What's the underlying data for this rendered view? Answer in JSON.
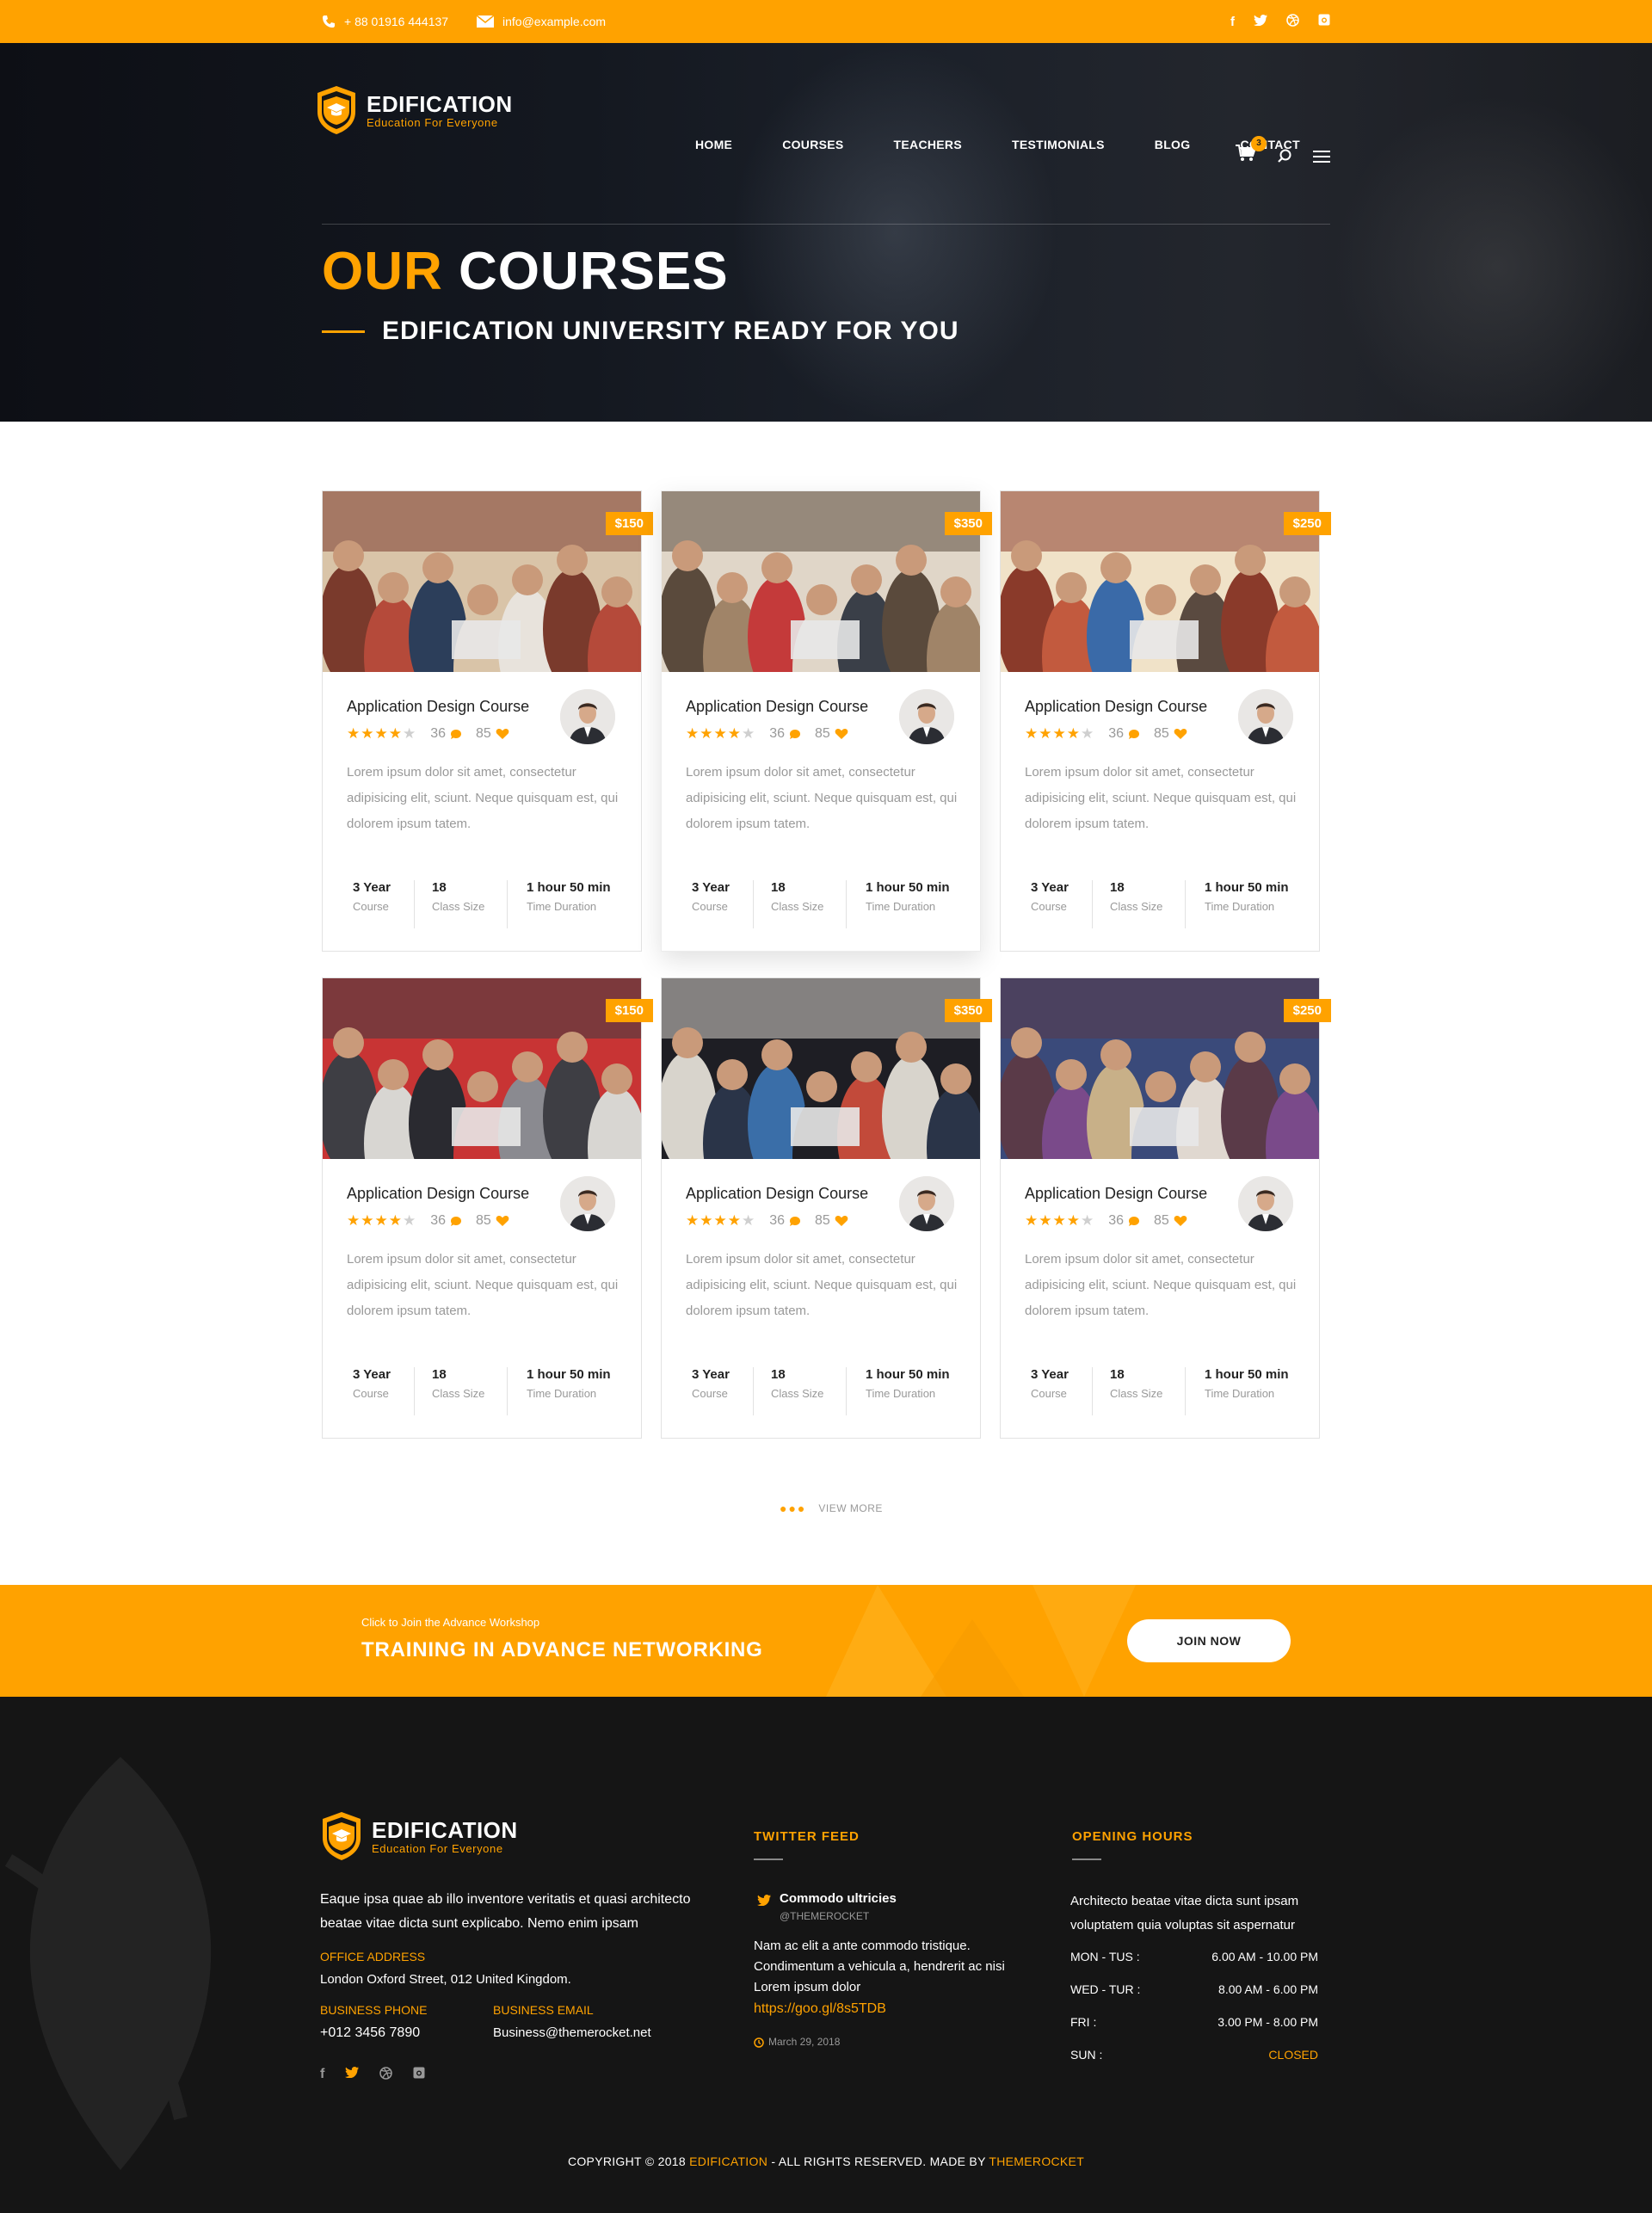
{
  "topbar": {
    "phone": "+ 88 01916 444137",
    "email": "info@example.com",
    "social": [
      "f",
      "t",
      "d",
      "i"
    ]
  },
  "brand": {
    "name": "EDIFICATION",
    "tagline": "Education For Everyone"
  },
  "nav": {
    "items": [
      "HOME",
      "COURSES",
      "TEACHERS",
      "TESTIMONIALS",
      "BLOG",
      "CONTACT"
    ],
    "cart_count": "3"
  },
  "hero": {
    "title_highlight": "OUR",
    "title_rest": "COURSES",
    "subtitle": "EDIFICATION UNIVERSITY READY FOR YOU"
  },
  "courses": [
    {
      "price": "$150",
      "title": "Application Design Course",
      "rating": 4,
      "comments": "36",
      "likes": "85",
      "description": "Lorem ipsum dolor sit amet, consectetur adipisicing elit, sciunt. Neque quisquam est, qui dolorem ipsum tatem.",
      "stats": [
        {
          "value": "3 Year",
          "label": "Course"
        },
        {
          "value": "18",
          "label": "Class Size"
        },
        {
          "value": "1 hour 50 min",
          "label": "Time Duration"
        }
      ]
    },
    {
      "price": "$350",
      "title": "Application Design Course",
      "rating": 4,
      "comments": "36",
      "likes": "85",
      "description": "Lorem ipsum dolor sit amet, consectetur adipisicing elit, sciunt. Neque quisquam est, qui dolorem ipsum tatem.",
      "stats": [
        {
          "value": "3 Year",
          "label": "Course"
        },
        {
          "value": "18",
          "label": "Class Size"
        },
        {
          "value": "1 hour 50 min",
          "label": "Time Duration"
        }
      ]
    },
    {
      "price": "$250",
      "title": "Application Design Course",
      "rating": 4,
      "comments": "36",
      "likes": "85",
      "description": "Lorem ipsum dolor sit amet, consectetur adipisicing elit, sciunt. Neque quisquam est, qui dolorem ipsum tatem.",
      "stats": [
        {
          "value": "3 Year",
          "label": "Course"
        },
        {
          "value": "18",
          "label": "Class Size"
        },
        {
          "value": "1 hour 50 min",
          "label": "Time Duration"
        }
      ]
    },
    {
      "price": "$150",
      "title": "Application Design Course",
      "rating": 4,
      "comments": "36",
      "likes": "85",
      "description": "Lorem ipsum dolor sit amet, consectetur adipisicing elit, sciunt. Neque quisquam est, qui dolorem ipsum tatem.",
      "stats": [
        {
          "value": "3 Year",
          "label": "Course"
        },
        {
          "value": "18",
          "label": "Class Size"
        },
        {
          "value": "1 hour 50 min",
          "label": "Time Duration"
        }
      ]
    },
    {
      "price": "$350",
      "title": "Application Design Course",
      "rating": 4,
      "comments": "36",
      "likes": "85",
      "description": "Lorem ipsum dolor sit amet, consectetur adipisicing elit, sciunt. Neque quisquam est, qui dolorem ipsum tatem.",
      "stats": [
        {
          "value": "3 Year",
          "label": "Course"
        },
        {
          "value": "18",
          "label": "Class Size"
        },
        {
          "value": "1 hour 50 min",
          "label": "Time Duration"
        }
      ]
    },
    {
      "price": "$250",
      "title": "Application Design Course",
      "rating": 4,
      "comments": "36",
      "likes": "85",
      "description": "Lorem ipsum dolor sit amet, consectetur adipisicing elit, sciunt. Neque quisquam est, qui dolorem ipsum tatem.",
      "stats": [
        {
          "value": "3 Year",
          "label": "Course"
        },
        {
          "value": "18",
          "label": "Class Size"
        },
        {
          "value": "1 hour 50 min",
          "label": "Time Duration"
        }
      ]
    }
  ],
  "view_more": "VIEW MORE",
  "banner": {
    "small": "Click to Join the Advance Workshop",
    "title": "TRAINING IN ADVANCE NETWORKING",
    "button": "JOIN NOW"
  },
  "footer": {
    "about": "Eaque ipsa quae ab illo inventore veritatis et quasi architecto beatae vitae dicta sunt explicabo. Nemo enim ipsam",
    "office_label": "OFFICE ADDRESS",
    "office": "London Oxford Street, 012 United Kingdom.",
    "phone_label": "BUSINESS PHONE",
    "phone": "+012 3456 7890",
    "email_label": "BUSINESS EMAIL",
    "email": "Business@themerocket.net",
    "twitter": {
      "heading": "TWITTER FEED",
      "name": "Commodo ultricies",
      "handle": "@THEMEROCKET",
      "text": "Nam ac elit a ante commodo tristique. Condimentum a vehicula a, hendrerit ac nisi Lorem ipsum dolor",
      "link": "https://goo.gl/8s5TDB",
      "date": "March 29, 2018"
    },
    "hours": {
      "heading": "OPENING HOURS",
      "intro": "Architecto beatae vitae dicta sunt ipsam voluptatem quia voluptas sit aspernatur",
      "rows": [
        {
          "day": "MON - TUS :",
          "time": "6.00 AM - 10.00 PM"
        },
        {
          "day": "WED - TUR :",
          "time": "8.00 AM - 6.00 PM"
        },
        {
          "day": "FRI :",
          "time": "3.00 PM - 8.00 PM"
        },
        {
          "day": "SUN :",
          "time": "CLOSED"
        }
      ]
    },
    "copyright_pre": "COPYRIGHT © 2018",
    "copyright_brand": "EDIFICATION",
    "copyright_mid": "-  ALL RIGHTS RESERVED. MADE BY",
    "copyright_maker": "THEMEROCKET"
  },
  "colors": {
    "accent": "#ffa200",
    "dark": "#151515"
  }
}
